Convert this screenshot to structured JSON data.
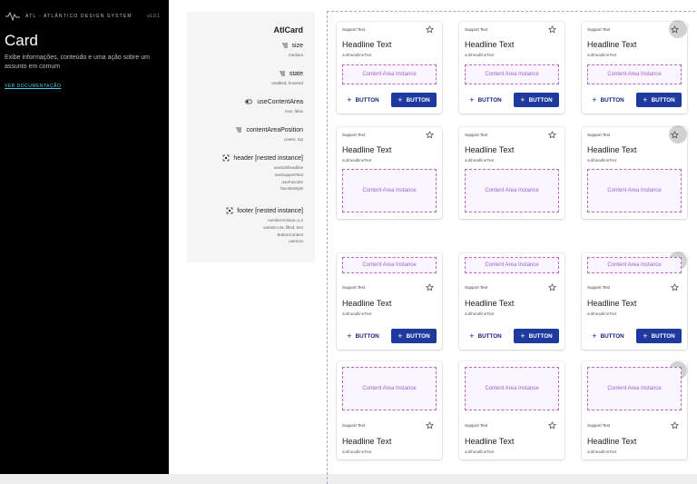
{
  "sidebar": {
    "brand": "ATL - ATLÂNTICO DESIGN SYSTEM",
    "version": "v1.0.1",
    "title": "Card",
    "description": "Exibe informações, conteúdo e uma ação sobre um assunto em comum",
    "doc_link": "VER DOCUMENTAÇÃO"
  },
  "properties": {
    "component_name": "AtlCard",
    "items": [
      {
        "label": "size",
        "icon": "list-icon",
        "values": [
          "medium"
        ]
      },
      {
        "label": "state",
        "icon": "list-icon",
        "values": [
          "enabled, hovered"
        ]
      },
      {
        "label": "useContentArea",
        "icon": "toggle-icon",
        "values": [
          "true, false"
        ]
      },
      {
        "label": "contentAreaPosition",
        "icon": "list-icon",
        "values": [
          "center, top"
        ]
      },
      {
        "label": "header [nested instance]",
        "icon": "instance-icon",
        "values": [
          "useSubheadline",
          "useSupportText",
          "useFavorite",
          "favoriteStyle"
        ]
      },
      {
        "label": "footer [nested instance]",
        "icon": "instance-icon",
        "values": [
          "numberActions=1,2",
          "variant=n/a, filled, text",
          "ButtonContext",
          "useIcon"
        ]
      }
    ]
  },
  "card": {
    "support_text": "Support Text",
    "headline": "Headline Text",
    "subheadline": "subheadlineText",
    "content_label": "Content Area Instance",
    "button_label": "BUTTON",
    "favorite_icon": "star-outline-icon",
    "add_icon": "plus-icon"
  },
  "colors": {
    "primary": "#1e3a9f",
    "content_border": "#ba68c8",
    "frame_border": "#b39ddb"
  }
}
